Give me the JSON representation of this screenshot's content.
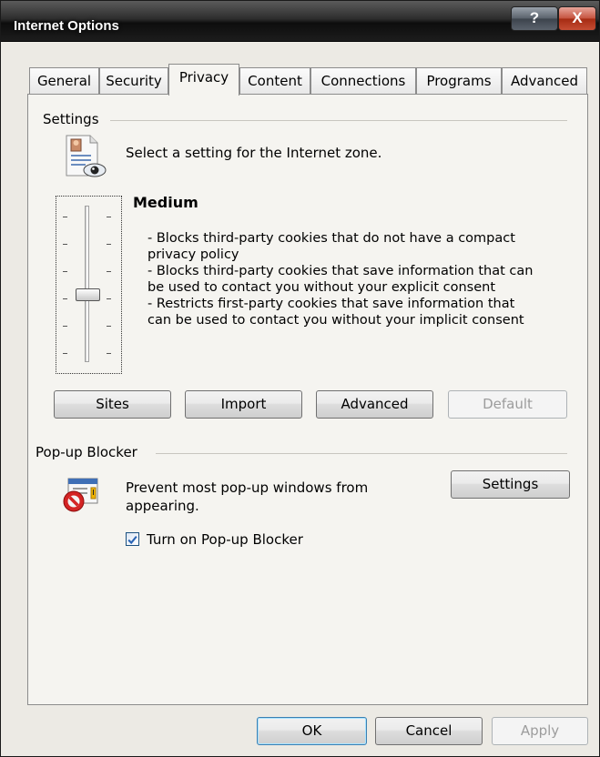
{
  "window": {
    "title": "Internet Options",
    "help_label": "?",
    "close_label": "X"
  },
  "tabs": [
    "General",
    "Security",
    "Privacy",
    "Content",
    "Connections",
    "Programs",
    "Advanced"
  ],
  "active_tab": "Privacy",
  "settings": {
    "group_label": "Settings",
    "select_text": "Select a setting for the Internet zone.",
    "level": "Medium",
    "slider_level_fraction": 0.5,
    "description": "- Blocks third-party cookies that do not have a compact\nprivacy policy\n- Blocks third-party cookies that save information that can\nbe used to contact you without your explicit consent\n- Restricts first-party cookies that save information that\ncan be used to contact you without your implicit consent",
    "buttons": {
      "sites": "Sites",
      "import": "Import",
      "advanced": "Advanced",
      "default": "Default"
    }
  },
  "popup_blocker": {
    "group_label": "Pop-up Blocker",
    "text": "Prevent most pop-up windows from appearing.",
    "settings_button": "Settings",
    "checkbox_label": "Turn on Pop-up Blocker",
    "checked": true
  },
  "footer": {
    "ok": "OK",
    "cancel": "Cancel",
    "apply": "Apply"
  },
  "colors": {
    "titlebar": "#1c1c1c",
    "close_button": "#c5523d",
    "accent_check": "#2a64b4"
  }
}
